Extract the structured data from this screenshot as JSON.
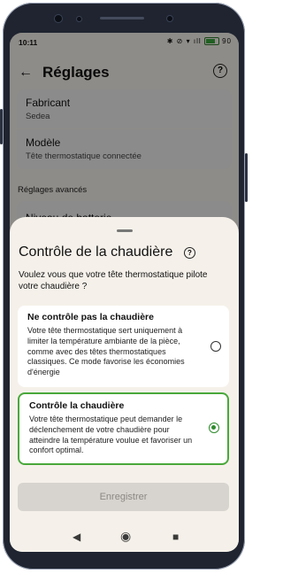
{
  "status_bar": {
    "time": "10:11",
    "icons": "✱ ⊘ ▾ ıll",
    "battery": "90"
  },
  "header": {
    "title": "Réglages",
    "back_icon": "back-arrow-icon",
    "help_icon": "help-circle-icon"
  },
  "settings": {
    "manufacturer": {
      "label": "Fabricant",
      "value": "Sedea"
    },
    "model": {
      "label": "Modèle",
      "value": "Tête thermostatique connectée"
    },
    "advanced_section": "Réglages avancés",
    "battery_item": {
      "label": "Niveau de batterie"
    }
  },
  "sheet": {
    "title": "Contrôle de la chaudière",
    "question": "Voulez vous que votre tête thermostatique pilote votre chaudière ?",
    "options": [
      {
        "title": "Ne contrôle pas la chaudière",
        "description": "Votre tête thermostatique sert uniquement à limiter la température ambiante de la pièce, comme avec des têtes thermostatiques classiques. Ce mode favorise les économies d'énergie",
        "selected": false
      },
      {
        "title": "Contrôle la chaudière",
        "description": "Votre tête thermostatique peut demander le déclenchement de votre chaudière pour atteindre la température voulue et favoriser un confort optimal.",
        "selected": true
      }
    ],
    "save_label": "Enregistrer"
  },
  "colors": {
    "accent": "#49a83b",
    "sheet_bg": "#f5f1ea",
    "disabled_button": "#d7d4cf"
  }
}
